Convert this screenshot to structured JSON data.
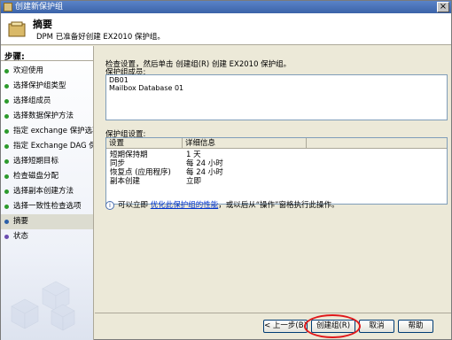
{
  "window": {
    "title": "创建新保护组"
  },
  "header": {
    "title": "摘要",
    "description": "DPM 已准备好创建 EX2010 保护组。"
  },
  "sidebar": {
    "steps_label": "步骤:",
    "items": [
      {
        "label": "欢迎使用",
        "state": "done"
      },
      {
        "label": "选择保护组类型",
        "state": "done"
      },
      {
        "label": "选择组成员",
        "state": "done"
      },
      {
        "label": "选择数据保护方法",
        "state": "done"
      },
      {
        "label": "指定 exchange 保护选项",
        "state": "done"
      },
      {
        "label": "指定 Exchange DAG 保护",
        "state": "done"
      },
      {
        "label": "选择短期目标",
        "state": "done"
      },
      {
        "label": "检查磁盘分配",
        "state": "done"
      },
      {
        "label": "选择副本创建方法",
        "state": "done"
      },
      {
        "label": "选择一致性检查选项",
        "state": "done"
      },
      {
        "label": "摘要",
        "state": "active"
      },
      {
        "label": "状态",
        "state": "pending"
      }
    ]
  },
  "main": {
    "intro": "检查设置，然后单击 创建组(R) 创建 EX2010 保护组。",
    "members_label": "保护组成员:",
    "members": [
      "DB01",
      "Mailbox Database 01"
    ],
    "settings_label": "保护组设置:",
    "settings_headers": [
      "设置",
      "详细信息"
    ],
    "settings_rows": [
      [
        "短期保持期",
        "1 天"
      ],
      [
        "同步",
        "每 24 小时"
      ],
      [
        "恢复点 (应用程序)",
        "每 24 小时"
      ],
      [
        "副本创建",
        "立即"
      ]
    ],
    "info_prefix": "可以立即",
    "info_link": "优化此保护组的性能",
    "info_suffix": "，或以后从“操作”窗格执行此操作。"
  },
  "buttons": {
    "back": "< 上一步(B)",
    "create": "创建组(R)",
    "cancel": "取消",
    "help": "帮助"
  },
  "colors": {
    "accent": "#3b63a8",
    "highlight": "#e0181a",
    "done_dot": "#2c9a2c"
  }
}
